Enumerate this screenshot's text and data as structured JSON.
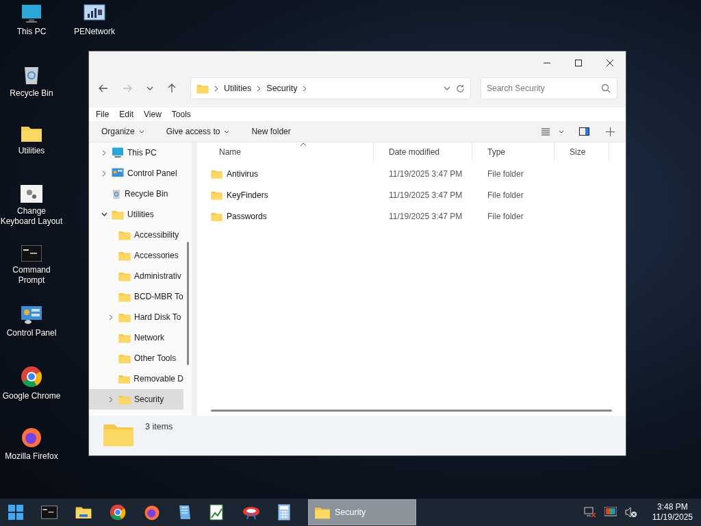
{
  "desktop": {
    "columns": [
      [
        {
          "label": "This PC",
          "kind": "pc"
        },
        {
          "label": "Recycle Bin",
          "kind": "recycle"
        },
        {
          "label": "Utilities",
          "kind": "folder"
        },
        {
          "label": "Change Keyboard Layout",
          "kind": "settings"
        },
        {
          "label": "Command Prompt",
          "kind": "cmd"
        },
        {
          "label": "Control Panel",
          "kind": "control-panel"
        },
        {
          "label": "Google Chrome",
          "kind": "chrome"
        },
        {
          "label": "Mozilla Firefox",
          "kind": "firefox"
        }
      ],
      [
        {
          "label": "PENetwork",
          "kind": "network"
        }
      ]
    ]
  },
  "window": {
    "address": {
      "crumbs": [
        "Utilities",
        "Security"
      ]
    },
    "search": {
      "placeholder": "Search Security"
    },
    "menu": [
      "File",
      "Edit",
      "View",
      "Tools"
    ],
    "commands": [
      {
        "label": "Organize",
        "dropdown": true
      },
      {
        "label": "Give access to",
        "dropdown": true
      },
      {
        "label": "New folder",
        "dropdown": false
      }
    ],
    "nav": [
      {
        "label": "This PC",
        "kind": "pc",
        "expanded": false,
        "selected": false
      },
      {
        "label": "Control Panel",
        "kind": "control-panel",
        "expanded": false,
        "selected": false
      },
      {
        "label": "Recycle Bin",
        "kind": "recycle",
        "selected": false
      },
      {
        "label": "Utilities",
        "kind": "folder",
        "expanded": true,
        "selected": false,
        "children": [
          {
            "label": "Accessibility",
            "kind": "folder",
            "selected": false
          },
          {
            "label": "Accessories",
            "kind": "folder",
            "selected": false
          },
          {
            "label": "Administrativ",
            "kind": "folder",
            "selected": false
          },
          {
            "label": "BCD-MBR To",
            "kind": "folder",
            "selected": false
          },
          {
            "label": "Hard Disk To",
            "kind": "folder",
            "expanded": false,
            "selected": false
          },
          {
            "label": "Network",
            "kind": "folder",
            "selected": false
          },
          {
            "label": "Other Tools",
            "kind": "folder",
            "selected": false
          },
          {
            "label": "Removable D",
            "kind": "folder",
            "selected": false
          },
          {
            "label": "Security",
            "kind": "folder",
            "expanded": false,
            "selected": true
          }
        ]
      }
    ],
    "columns": [
      {
        "label": "Name",
        "sorted": true
      },
      {
        "label": "Date modified",
        "sorted": false
      },
      {
        "label": "Type",
        "sorted": false
      },
      {
        "label": "Size",
        "sorted": false
      }
    ],
    "rows": [
      {
        "name": "Antivirus",
        "date": "11/19/2025 3:47 PM",
        "type": "File folder"
      },
      {
        "name": "KeyFinders",
        "date": "11/19/2025 3:47 PM",
        "type": "File folder"
      },
      {
        "name": "Passwords",
        "date": "11/19/2025 3:47 PM",
        "type": "File folder"
      }
    ],
    "status": "3 items"
  },
  "taskbar": {
    "apps": [
      {
        "kind": "cmd"
      },
      {
        "kind": "explorer"
      },
      {
        "kind": "chrome"
      },
      {
        "kind": "firefox"
      },
      {
        "kind": "notepad"
      },
      {
        "kind": "chart"
      },
      {
        "kind": "disk"
      },
      {
        "kind": "calculator"
      }
    ],
    "window_button": {
      "label": "Security",
      "selected": true
    },
    "time": "3:48 PM",
    "date": "11/19/2025"
  }
}
